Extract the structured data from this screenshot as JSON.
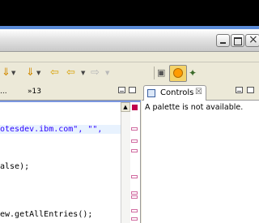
{
  "window": {
    "buttons": [
      "minimize",
      "maximize",
      "close"
    ]
  },
  "editor": {
    "overflow_tab": "»13",
    "code_lines": [
      {
        "text": "otesdev.ibm.com\", \"\","
      },
      {
        "text": "alse);"
      },
      {
        "text": "ew.getAllEntries();"
      }
    ]
  },
  "controls_view": {
    "tab_label": "Controls",
    "close_glyph": "☒",
    "message": "A palette is not available."
  },
  "icons": {
    "toolbar": [
      "run-icon",
      "debug-icon",
      "back-arrow-icon",
      "forward-arrow-icon",
      "open-perspective-icon",
      "notes-perspective-icon",
      "java-perspective-icon"
    ]
  }
}
